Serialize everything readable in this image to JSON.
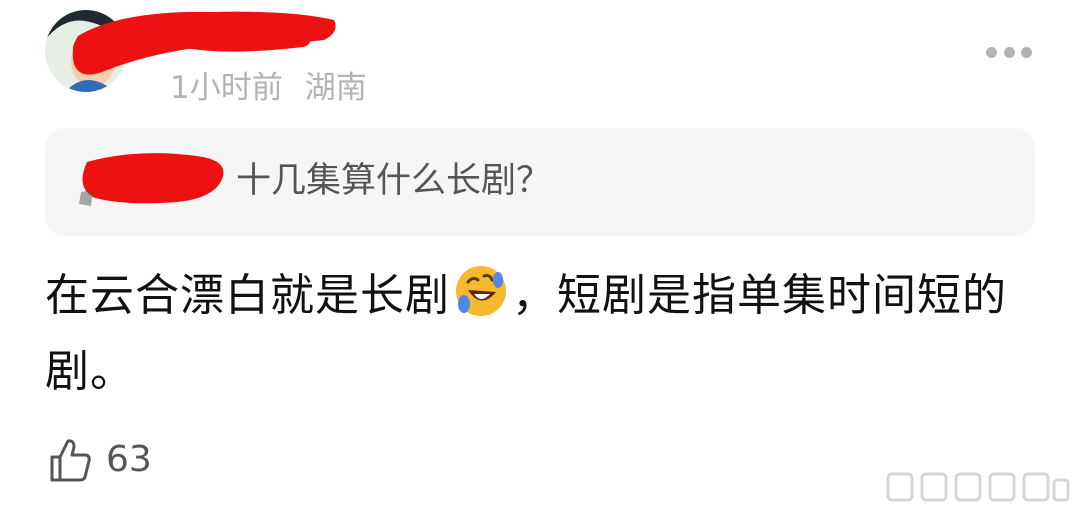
{
  "post": {
    "time": "1小时前",
    "location": "湖南",
    "quoted_reply": "十几集算什么长剧？",
    "content_part1": "在云合漂白就是长剧",
    "content_part2": "，短剧是指单集时间短的剧。",
    "like_count": "63"
  },
  "icons": {
    "more": "more-icon",
    "like": "thumbs-up-icon",
    "emoji": "rolling-laughing-emoji"
  },
  "colors": {
    "meta_text": "#b3b3b3",
    "redaction": "#ee1111",
    "quote_background": "#f6f6f6",
    "emoji_face": "#f5b82e"
  }
}
